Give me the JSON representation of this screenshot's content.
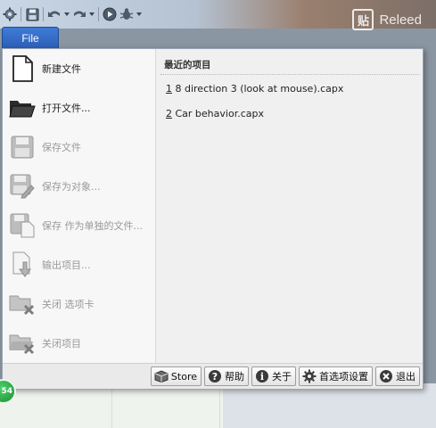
{
  "watermark": {
    "glyph": "贴",
    "text": "Releed"
  },
  "toolbar": {
    "icons": [
      "gear-icon",
      "save-icon",
      "undo-icon",
      "redo-icon",
      "run-icon",
      "debug-icon"
    ]
  },
  "file_tab": {
    "label": "File"
  },
  "menu": {
    "items": [
      {
        "label": "新建文件",
        "icon": "new-file-icon",
        "enabled": true
      },
      {
        "label": "打开文件...",
        "icon": "open-folder-icon",
        "enabled": true
      },
      {
        "label": "保存文件",
        "icon": "save-icon",
        "enabled": false
      },
      {
        "label": "保存为对象...",
        "icon": "save-as-icon",
        "enabled": false
      },
      {
        "label": "保存 作为单独的文件...",
        "icon": "save-single-file-icon",
        "enabled": false
      },
      {
        "label": "输出项目...",
        "icon": "export-icon",
        "enabled": false
      },
      {
        "label": "关闭 选项卡",
        "icon": "close-tab-icon",
        "enabled": false
      },
      {
        "label": "关闭项目",
        "icon": "close-project-icon",
        "enabled": false
      }
    ]
  },
  "recent": {
    "header": "最近的项目",
    "items": [
      {
        "num": "1",
        "name": " 8 direction 3 (look at mouse).capx"
      },
      {
        "num": "2",
        "name": " Car behavior.capx"
      }
    ]
  },
  "bottom_buttons": {
    "store": "Store",
    "help": "帮助",
    "about": "关于",
    "preferences": "首选项设置",
    "exit": "退出"
  },
  "badge": {
    "text": "54"
  },
  "colors": {
    "file_tab": "#2f66c2",
    "panel_bg": "#f0f0f0",
    "badge_green": "#1c8e34"
  }
}
